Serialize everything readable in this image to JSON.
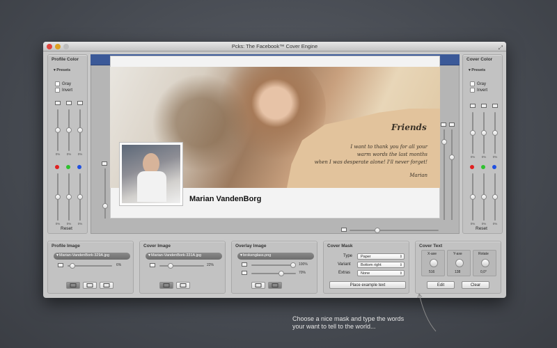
{
  "window": {
    "title": "Pcks: The Facebook™ Cover Engine"
  },
  "profile_color": {
    "title": "Profile Color",
    "presets": "Presets",
    "gray_label": "Gray",
    "invert_label": "Invert",
    "percents": [
      "0%",
      "0%",
      "0%"
    ],
    "percents_bottom": [
      "0%",
      "0%",
      "0%"
    ],
    "reset_label": "Reset",
    "levels_top": [
      0.5,
      0.5,
      0.5
    ],
    "levels_bottom": [
      0.5,
      0.5,
      0.5
    ]
  },
  "cover_color": {
    "title": "Cover Color",
    "presets": "Presets",
    "gray_label": "Gray",
    "invert_label": "Invert",
    "percents": [
      "0%",
      "0%",
      "0%"
    ],
    "percents_bottom": [
      "0%",
      "0%",
      "0%"
    ],
    "reset_label": "Reset",
    "levels_top": [
      0.5,
      0.5,
      0.5
    ],
    "levels_bottom": [
      0.5,
      0.5,
      0.5
    ]
  },
  "preview": {
    "friends_heading": "Friends",
    "message_lines": [
      "I want to thank you for all your",
      "warm words the last months",
      "when I was desperate alone! I'll never forget!"
    ],
    "signature": "Marian",
    "profile_name": "Marian VandenBorg",
    "zoom_level": 0.3
  },
  "profile_image": {
    "title": "Profile Image",
    "file": "Marian-VandenBork-329A.jpg",
    "percent": "6%",
    "level": 0.06
  },
  "cover_image": {
    "title": "Cover Image",
    "file": "Marian-VandenBork-331A.jpg",
    "percent": "22%",
    "level": 0.22
  },
  "overlay_image": {
    "title": "Overlay Image",
    "file": "brokenglass.png",
    "percent_1": "100%",
    "percent_2": "70%",
    "level_1": 1.0,
    "level_2": 0.7
  },
  "cover_mask": {
    "title": "Cover Mask",
    "type_label": "Type",
    "type_value": "Paper",
    "variant_label": "Variant",
    "variant_value": "Bottom right",
    "extras_label": "Extras",
    "extras_value": "None",
    "example_button": "Place example text"
  },
  "cover_text": {
    "title": "Cover Text",
    "xaxe_label": "X-axe",
    "xaxe_value": "516",
    "yaxe_label": "Y-axe",
    "yaxe_value": "138",
    "rotate_label": "Rotate",
    "rotate_value": "0,0°",
    "edit_button": "Edit",
    "clear_button": "Clear"
  },
  "caption": {
    "line1": "Choose a nice mask and type the words",
    "line2": "your want to tell to the world..."
  },
  "colors": {
    "facebook_blue": "#3b5998",
    "red": "#e02020",
    "green": "#2ec12e",
    "blue": "#2050e0"
  }
}
